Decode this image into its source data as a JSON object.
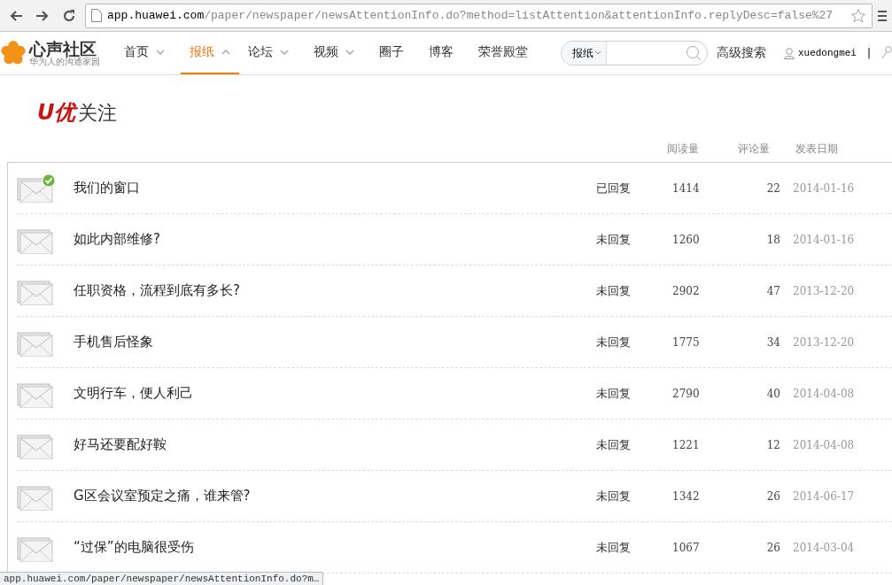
{
  "browser": {
    "url_host": "app.huawei.com",
    "url_path": "/paper/newspaper/newsAttentionInfo.do?method=listAttention&attentionInfo.replyDesc=false%27"
  },
  "site": {
    "logo_title": "心声社区",
    "logo_subtitle": "华为人的沟通家园",
    "nav": [
      {
        "label": "首页",
        "has_menu": true,
        "selected": false
      },
      {
        "label": "报纸",
        "has_menu": true,
        "selected": true
      },
      {
        "label": "论坛",
        "has_menu": true,
        "selected": false
      },
      {
        "label": "视频",
        "has_menu": true,
        "selected": false
      },
      {
        "label": "圈子",
        "has_menu": false,
        "selected": false
      },
      {
        "label": "博客",
        "has_menu": false,
        "selected": false
      },
      {
        "label": "荣誉殿堂",
        "has_menu": false,
        "selected": false
      }
    ],
    "search_scope": "报纸",
    "advanced_search": "高级搜索",
    "username": "xuedongmei",
    "separator": "|"
  },
  "page": {
    "title_mark": "U优",
    "title": "关注",
    "columns": [
      "阅读量",
      "评论量",
      "发表日期"
    ],
    "rows": [
      {
        "title": "我们的窗口",
        "replied": true,
        "status": "已回复",
        "reads": "1414",
        "comments": "22",
        "date": "2014-01-16"
      },
      {
        "title": "如此内部维修?",
        "replied": false,
        "status": "未回复",
        "reads": "1260",
        "comments": "18",
        "date": "2014-01-16"
      },
      {
        "title": "任职资格，流程到底有多长?",
        "replied": false,
        "status": "未回复",
        "reads": "2902",
        "comments": "47",
        "date": "2013-12-20"
      },
      {
        "title": "手机售后怪象",
        "replied": false,
        "status": "未回复",
        "reads": "1775",
        "comments": "34",
        "date": "2013-12-20"
      },
      {
        "title": "文明行车，便人利己",
        "replied": false,
        "status": "未回复",
        "reads": "2790",
        "comments": "40",
        "date": "2014-04-08"
      },
      {
        "title": "好马还要配好鞍",
        "replied": false,
        "status": "未回复",
        "reads": "1221",
        "comments": "12",
        "date": "2014-04-08"
      },
      {
        "title": "G区会议室预定之痛，谁来管?",
        "replied": false,
        "status": "未回复",
        "reads": "1342",
        "comments": "26",
        "date": "2014-06-17"
      },
      {
        "title": "“过保”的电脑很受伤",
        "replied": false,
        "status": "未回复",
        "reads": "1067",
        "comments": "26",
        "date": "2014-03-04"
      }
    ]
  },
  "status_bar": "app.huawei.com/paper/newspaper/newsAttentionInfo.do?m…"
}
